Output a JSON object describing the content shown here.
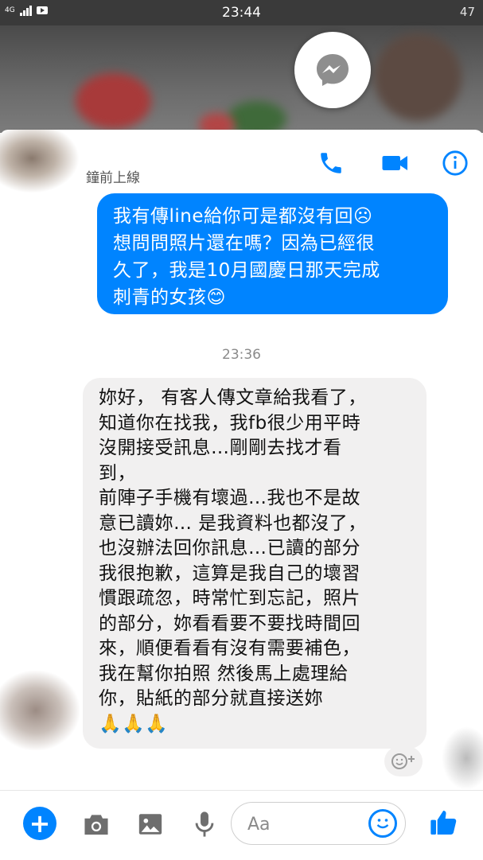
{
  "status_bar": {
    "network": "4G",
    "time": "23:44",
    "battery": "47"
  },
  "header": {
    "presence": "鐘前上線",
    "icons": [
      "phone-icon",
      "video-camera-icon",
      "info-icon"
    ]
  },
  "messages": {
    "outgoing": {
      "lines": [
        "我有傳line給你可是都沒有回☹",
        "想問問照片還在嗎？因為已經很",
        "久了，我是10月國慶日那天完成",
        "刺青的女孩😊"
      ]
    },
    "timestamp": "23:36",
    "incoming": {
      "lines": [
        "妳好， 有客人傳文章給我看了，",
        "知道你在找我，我fb很少用平時",
        "沒開接受訊息…剛剛去找才看",
        "到，",
        "前陣子手機有壞過…我也不是故",
        "意已讀妳… 是我資料也都沒了，",
        "也沒辦法回你訊息…已讀的部分",
        "我很抱歉，這算是我自己的壞習",
        "慣跟疏忽，時常忙到忘記，照片",
        "的部分，妳看看要不要找時間回",
        "來，順便看看有沒有需要補色，",
        "我在幫你拍照 然後馬上處理給",
        "你，貼紙的部分就直接送妳",
        "🙏🙏🙏"
      ]
    }
  },
  "composer": {
    "placeholder": "Aa",
    "icons": [
      "plus-icon",
      "camera-icon",
      "image-icon",
      "microphone-icon",
      "emoji-icon",
      "thumbs-up-icon"
    ]
  },
  "colors": {
    "accent": "#0084ff",
    "incoming_bubble": "#f1f0f0",
    "status_bar": "#3a3a3a"
  }
}
